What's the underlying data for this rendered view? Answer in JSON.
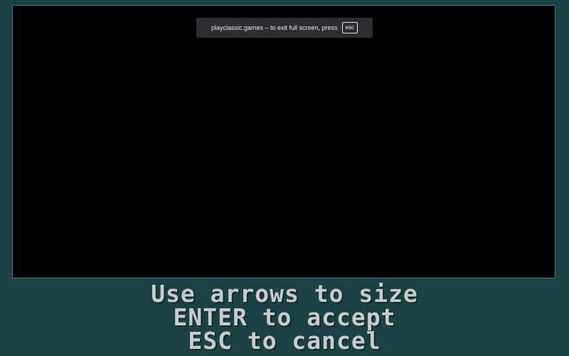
{
  "fullscreen_notice": {
    "message": "playclassic.games – to exit full screen, press",
    "key_label": "esc"
  },
  "instructions": {
    "line1": "Use arrows to size",
    "line2": "ENTER to accept",
    "line3": "ESC to cancel"
  },
  "colors": {
    "background": "#1c4142",
    "screen": "#000000",
    "text": "#c9cbca",
    "notice_bg": "#2b2d30"
  }
}
